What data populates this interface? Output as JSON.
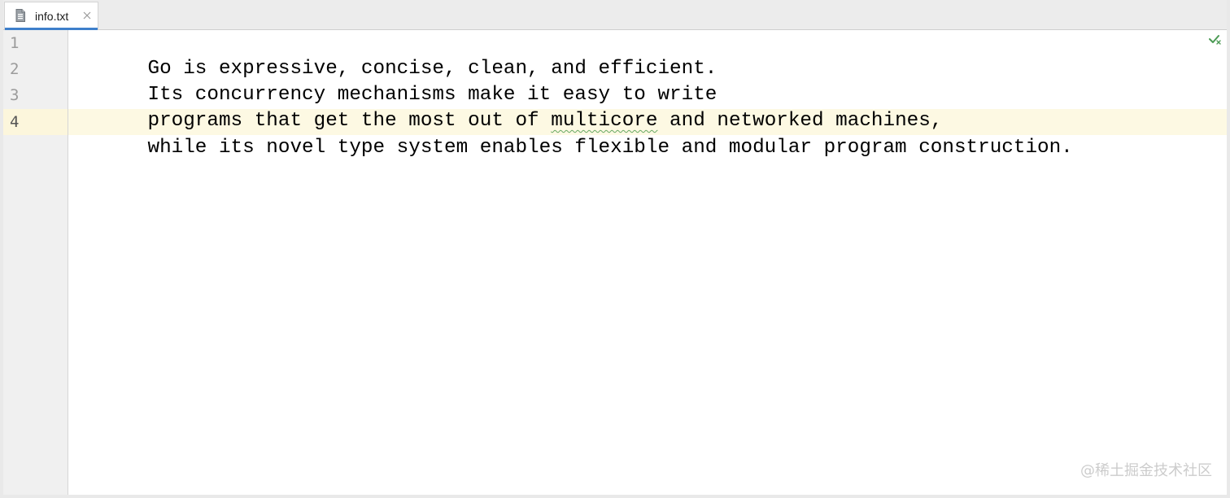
{
  "tabs": [
    {
      "label": "info.txt",
      "active": true,
      "icon": "text-file-icon",
      "close_icon": "close-icon",
      "close_glyph": "✕"
    }
  ],
  "editor": {
    "line_numbers": [
      "1",
      "2",
      "3",
      "4"
    ],
    "current_line": 4,
    "lines": [
      {
        "segments": [
          {
            "text": "Go is expressive, concise, clean, and efficient.",
            "squiggle": false
          }
        ]
      },
      {
        "segments": [
          {
            "text": "Its concurrency mechanisms make it easy to write",
            "squiggle": false
          }
        ]
      },
      {
        "segments": [
          {
            "text": "programs that get the most out of ",
            "squiggle": false
          },
          {
            "text": "multicore",
            "squiggle": true
          },
          {
            "text": " and networked machines,",
            "squiggle": false
          }
        ]
      },
      {
        "segments": [
          {
            "text": "while its novel type system enables flexible and modular program construction.",
            "squiggle": false
          }
        ]
      }
    ],
    "inspection_icon": "inspection-ok-icon"
  },
  "watermark": {
    "text": "@稀土掘金技术社区"
  },
  "colors": {
    "tab_accent": "#3e7fcb",
    "current_line_bg": "#fdf9e3",
    "typo_underline": "#67a862",
    "inspection_ok": "#4b9a54"
  }
}
